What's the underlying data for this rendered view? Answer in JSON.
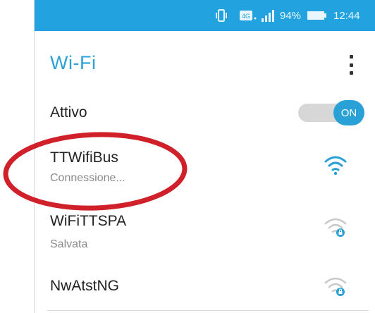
{
  "status_bar": {
    "network_type": "4G",
    "battery_percent": "94%",
    "time": "12:44",
    "icons": [
      "vibrate-icon",
      "4g-icon",
      "signal-icon",
      "battery-icon"
    ]
  },
  "header": {
    "title": "Wi-Fi",
    "menu_icon": "more-vert-icon"
  },
  "wifi_toggle": {
    "label": "Attivo",
    "state_label": "ON",
    "on": true
  },
  "networks": [
    {
      "name": "TTWifiBus",
      "status": "Connessione...",
      "icon": "wifi-signal-icon",
      "secured": false,
      "highlighted": true
    },
    {
      "name": "WiFiTTSPA",
      "status": "Salvata",
      "icon": "wifi-locked-icon",
      "secured": true
    },
    {
      "name": "NwAtstNG",
      "status": "",
      "icon": "wifi-locked-icon",
      "secured": true
    }
  ],
  "colors": {
    "status_bar": "#22a3e0",
    "accent": "#2aa1d6",
    "annotation": "#d0202a"
  }
}
